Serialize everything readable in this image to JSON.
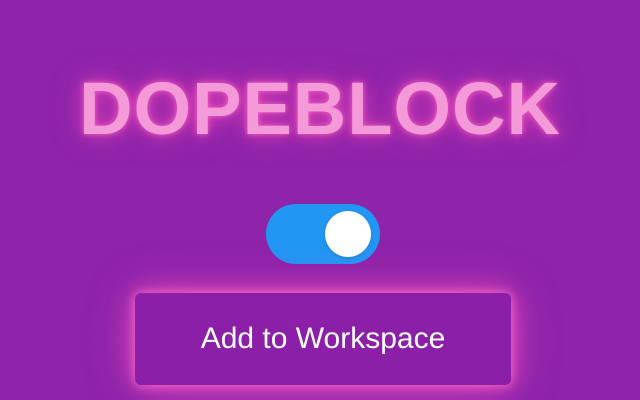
{
  "app": {
    "title": "DOPEBLOCK"
  },
  "toggle": {
    "state": "on",
    "accent_color": "#2196f3"
  },
  "cta": {
    "label": "Add to Workspace"
  },
  "colors": {
    "background": "#8e24aa",
    "title_glow": "#f59ad8",
    "button_glow": "#ff6ec8"
  }
}
